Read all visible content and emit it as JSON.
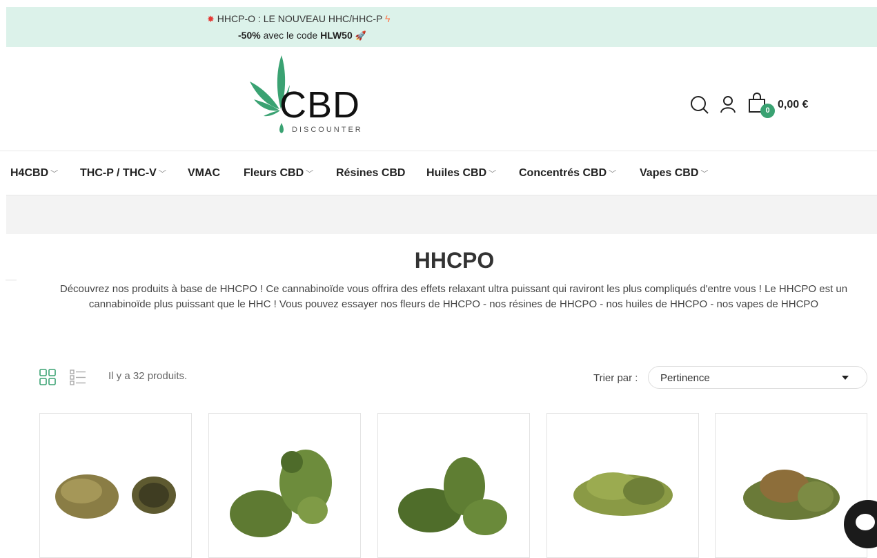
{
  "promo": {
    "star": "✸",
    "product_link": "HHCP-O",
    "headline_rest": " : LE NOUVEAU HHC/HHC-P ",
    "bolt": "ϟ",
    "discount": "-50%",
    "discount_text": " avec le code ",
    "code": "HLW50",
    "rocket": "🚀"
  },
  "logo": {
    "main": "CBD",
    "sub": "DISCOUNTER"
  },
  "header": {
    "cart_count": "0",
    "cart_total": "0,00 €"
  },
  "nav": {
    "items": [
      {
        "label": "H4CBD",
        "has_submenu": true
      },
      {
        "label": "THC-P / THC-V",
        "has_submenu": true
      },
      {
        "label": "VMAC",
        "has_submenu": false
      },
      {
        "label": "Fleurs CBD",
        "has_submenu": true
      },
      {
        "label": "Résines CBD",
        "has_submenu": false
      },
      {
        "label": "Huiles CBD",
        "has_submenu": true
      },
      {
        "label": "Concentrés CBD",
        "has_submenu": true
      },
      {
        "label": "Vapes CBD",
        "has_submenu": true
      }
    ],
    "chevron": "﹀"
  },
  "category": {
    "title": "HHCPO",
    "description": "Découvrez nos produits à base de HHCPO ! Ce cannabinoïde vous offrira des effets relaxant ultra puissant qui raviront les plus compliqués d'entre vous ! Le HHCPO est un cannabinoïde plus puissant que le HHC ! Vous pouvez essayer nos fleurs de HHCPO - nos résines de HHCPO - nos huiles de HHCPO - nos vapes de HHCPO"
  },
  "listing": {
    "count_text": "Il y a 32 produits.",
    "sort_label": "Trier par :",
    "sort_value": "Pertinence"
  },
  "colors": {
    "accent": "#3aa272",
    "promo_bg": "#dcf2ea",
    "leaf": "#3aa272"
  }
}
